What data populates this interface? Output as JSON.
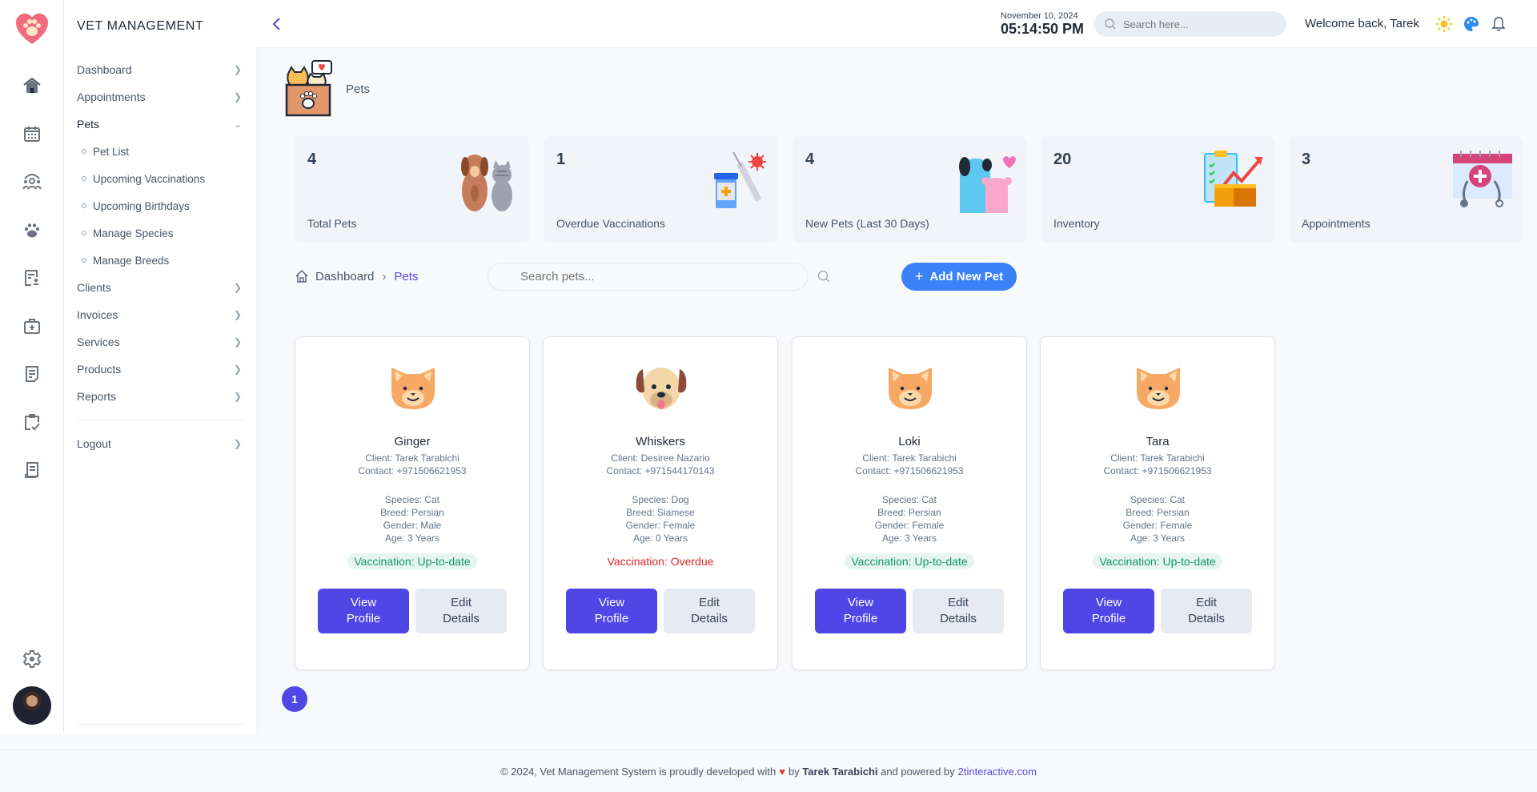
{
  "app": {
    "brand": "VET MANAGEMENT"
  },
  "menu": {
    "items": [
      {
        "label": "Dashboard",
        "chevron": "right"
      },
      {
        "label": "Appointments",
        "chevron": "right"
      },
      {
        "label": "Pets",
        "chevron": "down",
        "expanded": true
      },
      {
        "label": "Clients",
        "chevron": "right"
      },
      {
        "label": "Invoices",
        "chevron": "right"
      },
      {
        "label": "Services",
        "chevron": "right"
      },
      {
        "label": "Products",
        "chevron": "right"
      },
      {
        "label": "Reports",
        "chevron": "right"
      }
    ],
    "pets_sub": [
      "Pet List",
      "Upcoming Vaccinations",
      "Upcoming Birthdays",
      "Manage Species",
      "Manage Breeds"
    ],
    "logout": "Logout"
  },
  "rail": {
    "icons": [
      "home-icon",
      "calendar-icon",
      "clients-icon",
      "paw-icon",
      "report-icon",
      "medical-kit-icon",
      "document-icon",
      "clipboard-check-icon",
      "receipt-icon"
    ],
    "settings": "gear-icon"
  },
  "topbar": {
    "date": "November 10, 2024",
    "time": "05:14:50 PM",
    "search_placeholder": "Search here...",
    "welcome": "Welcome back, Tarek"
  },
  "page": {
    "title": "Pets",
    "breadcrumb": {
      "home": "Dashboard",
      "current": "Pets"
    },
    "search_placeholder": "Search pets...",
    "add_button": "Add New Pet"
  },
  "stats": [
    {
      "value": "4",
      "label": "Total Pets"
    },
    {
      "value": "1",
      "label": "Overdue Vaccinations"
    },
    {
      "value": "4",
      "label": "New Pets (Last 30 Days)"
    },
    {
      "value": "20",
      "label": "Inventory"
    },
    {
      "value": "3",
      "label": "Appointments"
    }
  ],
  "pets": [
    {
      "name": "Ginger",
      "client": "Client: Tarek Tarabichi",
      "contact": "Contact: +971506621953",
      "species": "Species: Cat",
      "breed": "Breed: Persian",
      "gender": "Gender: Male",
      "age": "Age: 3 Years",
      "vaccination": "Vaccination: Up-to-date",
      "vacc_status": "ok",
      "face": "cat"
    },
    {
      "name": "Whiskers",
      "client": "Client: Desiree Nazario",
      "contact": "Contact: +971544170143",
      "species": "Species: Dog",
      "breed": "Breed: Siamese",
      "gender": "Gender: Female",
      "age": "Age: 0 Years",
      "vaccination": "Vaccination: Overdue",
      "vacc_status": "bad",
      "face": "dog"
    },
    {
      "name": "Loki",
      "client": "Client: Tarek Tarabichi",
      "contact": "Contact: +971506621953",
      "species": "Species: Cat",
      "breed": "Breed: Persian",
      "gender": "Gender: Female",
      "age": "Age: 3 Years",
      "vaccination": "Vaccination: Up-to-date",
      "vacc_status": "ok",
      "face": "cat"
    },
    {
      "name": "Tara",
      "client": "Client: Tarek Tarabichi",
      "contact": "Contact: +971506621953",
      "species": "Species: Cat",
      "breed": "Breed: Persian",
      "gender": "Gender: Female",
      "age": "Age: 3 Years",
      "vaccination": "Vaccination: Up-to-date",
      "vacc_status": "ok",
      "face": "cat"
    }
  ],
  "card_buttons": {
    "view": "View Profile",
    "edit": "Edit Details"
  },
  "pagination": {
    "current": "1"
  },
  "footer": {
    "prefix": "© 2024, Vet Management System is proudly developed with",
    "heart": "♥",
    "by": "by",
    "author": "Tarek Tarabichi",
    "powered": "and powered by",
    "link": "2tinteractive.com"
  },
  "colors": {
    "primary": "#4f46e5",
    "add_button": "#3b82f6",
    "ok": "#15966b",
    "overdue": "#dc2626"
  }
}
